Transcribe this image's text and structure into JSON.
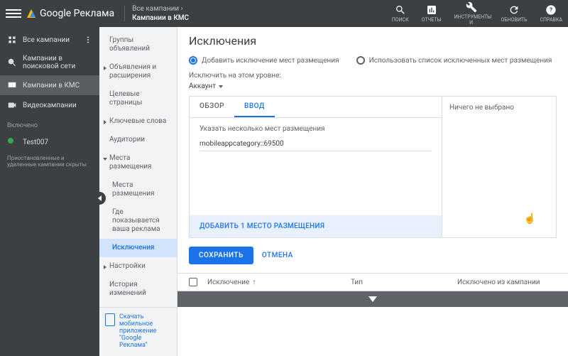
{
  "header": {
    "product": "Google Реклама",
    "breadcrumb_top": "Все кампании  ›",
    "breadcrumb_bottom": "Кампании в КМС",
    "icons": {
      "search": "ПОИСК",
      "reports": "ОТЧЕТЫ",
      "tools": "ИНСТРУМЕНТЫ И",
      "refresh": "ОБНОВИТЬ",
      "help": "СПРАВКА"
    }
  },
  "leftnav": {
    "items": [
      {
        "label": "Все кампании"
      },
      {
        "label": "Кампании в поисковой сети"
      },
      {
        "label": "Кампании в КМС"
      },
      {
        "label": "Видеокампании"
      }
    ],
    "included_label": "Включено",
    "account": "Test007",
    "hidden_note": "Приостановленные и удаленные кампании скрыты"
  },
  "midnav": {
    "items": [
      "Группы объявлений",
      "Объявления и расширения",
      "Целевые страницы",
      "Ключевые слова",
      "Аудитории",
      "Места размещения",
      "Места размещения",
      "Где показывается ваша реклама",
      "Исключения",
      "Настройки",
      "История изменений"
    ],
    "download": "Скачать мобильное приложение \"Google Реклама\""
  },
  "main": {
    "title": "Исключения",
    "radio_add": "Добавить исключение мест размещения",
    "radio_use": "Использовать список исключенных мест размещения",
    "level_label": "Исключить на этом уровне:",
    "level_value": "Аккаунт",
    "tabs": {
      "overview": "ОБЗОР",
      "input": "ВВОД"
    },
    "panel": {
      "hint": "Указать несколько мест размещения",
      "value": "mobileappcategory::69500",
      "empty": "Ничего не выбрано",
      "add_btn": "ДОБАВИТЬ 1 МЕСТО РАЗМЕЩЕНИЯ"
    },
    "actions": {
      "save": "СОХРАНИТЬ",
      "cancel": "ОТМЕНА"
    },
    "table": {
      "col1": "Исключение",
      "col2": "Тип",
      "col3": "Исключено из кампании"
    }
  }
}
